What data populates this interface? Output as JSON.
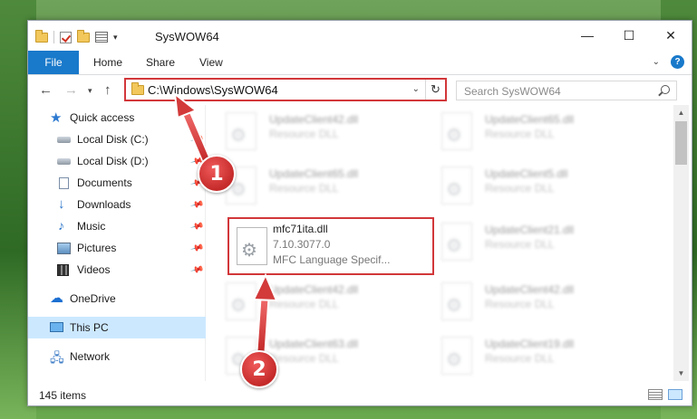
{
  "window": {
    "title": "SysWOW64",
    "controls": {
      "minimize": "—",
      "maximize": "☐",
      "close": "✕"
    }
  },
  "ribbon": {
    "tabs": [
      {
        "label": "File"
      },
      {
        "label": "Home"
      },
      {
        "label": "Share"
      },
      {
        "label": "View"
      }
    ],
    "help": "?"
  },
  "address": {
    "path": "C:\\Windows\\SysWOW64",
    "search_placeholder": "Search SysWOW64"
  },
  "nav_pane": {
    "items": [
      {
        "label": "Quick access",
        "icon": "star-icon",
        "pinned": false
      },
      {
        "label": "Local Disk (C:)",
        "icon": "drive-icon",
        "pinned": true
      },
      {
        "label": "Local Disk (D:)",
        "icon": "drive-icon",
        "pinned": true
      },
      {
        "label": "Documents",
        "icon": "documents-icon",
        "pinned": true
      },
      {
        "label": "Downloads",
        "icon": "downloads-icon",
        "pinned": true
      },
      {
        "label": "Music",
        "icon": "music-icon",
        "pinned": true
      },
      {
        "label": "Pictures",
        "icon": "pictures-icon",
        "pinned": true
      },
      {
        "label": "Videos",
        "icon": "videos-icon",
        "pinned": true
      },
      {
        "label": "OneDrive",
        "icon": "onedrive-icon",
        "pinned": false
      },
      {
        "label": "This PC",
        "icon": "this-pc-icon",
        "pinned": false,
        "selected": true
      },
      {
        "label": "Network",
        "icon": "network-icon",
        "pinned": false
      }
    ]
  },
  "files": [
    {
      "name": "UpdateClient42.dll",
      "type": "Resource DLL",
      "blurred": true
    },
    {
      "name": "UpdateClient65.dll",
      "type": "Resource DLL",
      "blurred": true
    },
    {
      "name": "UpdateClient65.dll",
      "type": "Resource DLL",
      "blurred": true
    },
    {
      "name": "UpdateClient5.dll",
      "type": "Resource DLL",
      "blurred": true
    },
    {
      "name": "mfc71ita.dll",
      "version": "7.10.3077.0",
      "type": "MFC Language Specif...",
      "blurred": false,
      "highlighted": true
    },
    {
      "name": "UpdateClient21.dll",
      "type": "Resource DLL",
      "blurred": true
    },
    {
      "name": "UpdateClient42.dll",
      "type": "Resource DLL",
      "blurred": true
    },
    {
      "name": "UpdateClient42.dll",
      "type": "Resource DLL",
      "blurred": true
    },
    {
      "name": "UpdateClient63.dll",
      "type": "Resource DLL",
      "blurred": true
    },
    {
      "name": "UpdateClient19.dll",
      "type": "Resource DLL",
      "blurred": true
    }
  ],
  "status": {
    "item_count": "145 items"
  },
  "annotations": [
    {
      "label": "1"
    },
    {
      "label": "2"
    }
  ],
  "colors": {
    "accent": "#1979ca",
    "highlight": "#d2373a",
    "selected": "#cce8ff"
  }
}
